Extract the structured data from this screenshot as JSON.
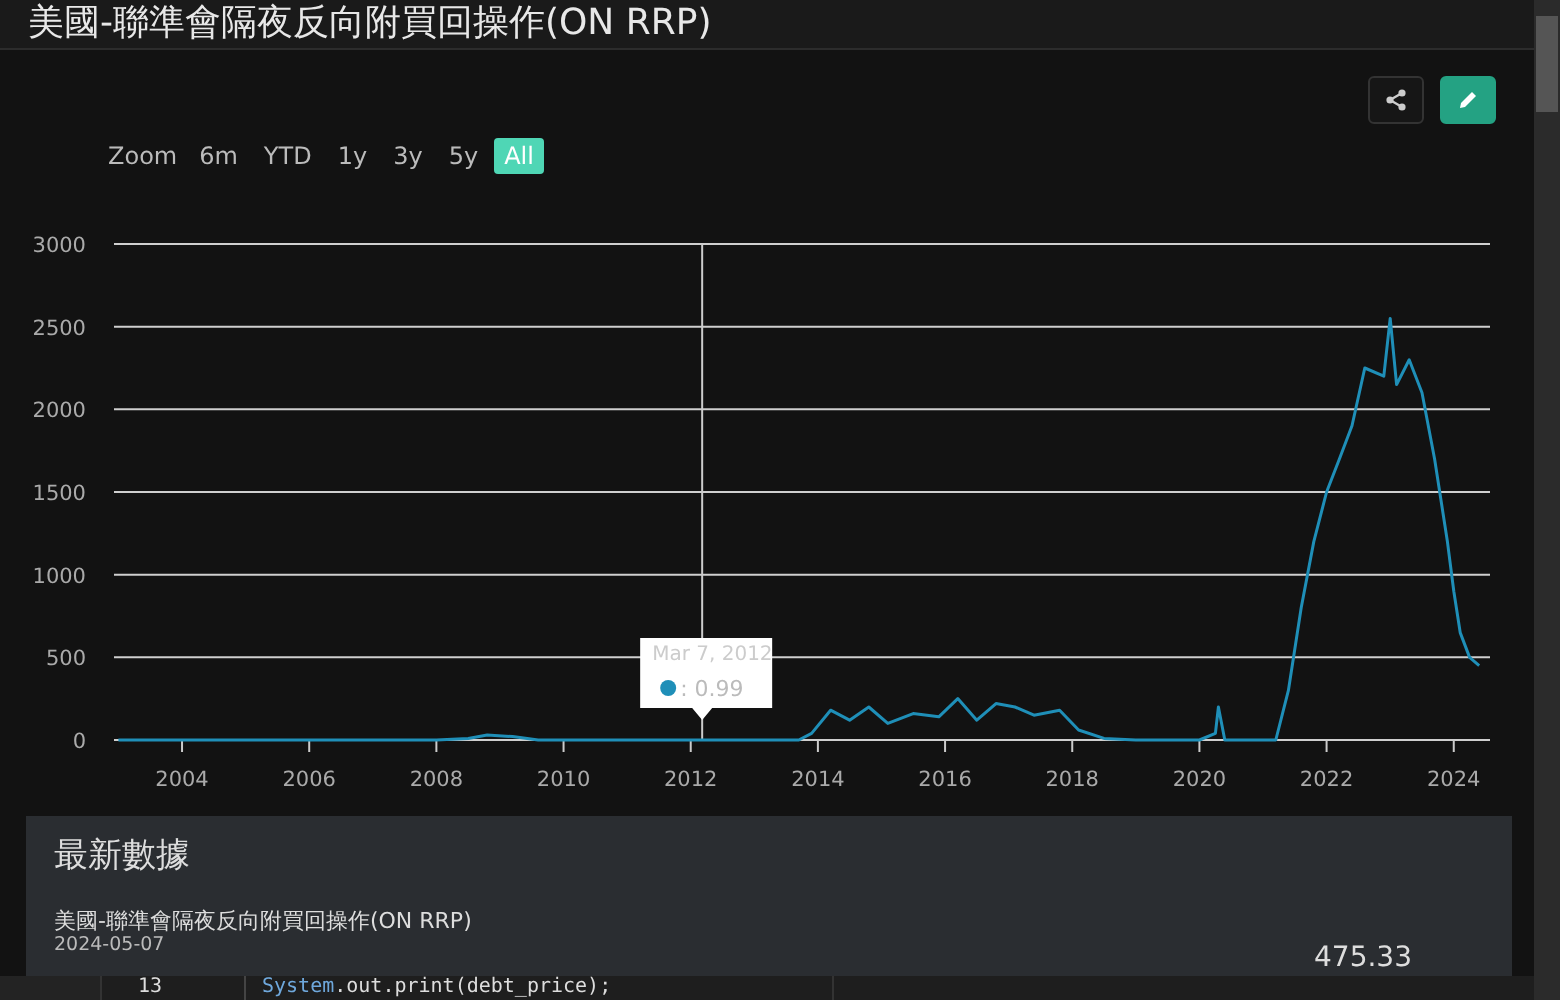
{
  "header": {
    "title": "美國-聯準會隔夜反向附買回操作(ON RRP)"
  },
  "chart_toolbar": {
    "buttons": [
      {
        "kind": "share",
        "selected": false
      },
      {
        "kind": "edit",
        "selected": true
      }
    ]
  },
  "range_selector": {
    "label": "Zoom",
    "options": [
      {
        "label": "6m",
        "selected": false
      },
      {
        "label": "YTD",
        "selected": false
      },
      {
        "label": "1y",
        "selected": false
      },
      {
        "label": "3y",
        "selected": false
      },
      {
        "label": "5y",
        "selected": false
      },
      {
        "label": "All",
        "selected": true
      }
    ]
  },
  "chart": {
    "chart_data": {
      "type": "line",
      "x": [
        2003.0,
        2008.0,
        2008.5,
        2008.8,
        2009.2,
        2009.6,
        2013.7,
        2013.9,
        2014.2,
        2014.5,
        2014.8,
        2015.1,
        2015.5,
        2015.9,
        2016.2,
        2016.5,
        2016.8,
        2017.1,
        2017.4,
        2017.8,
        2018.1,
        2018.5,
        2019.0,
        2020.0,
        2020.25,
        2020.3,
        2020.4,
        2021.2,
        2021.4,
        2021.6,
        2021.8,
        2022.0,
        2022.2,
        2022.4,
        2022.6,
        2022.9,
        2023.0,
        2023.1,
        2023.3,
        2023.5,
        2023.7,
        2023.9,
        2024.0,
        2024.1,
        2024.25,
        2024.4
      ],
      "series": [
        {
          "color": "#1f8fb8",
          "values": [
            0,
            0,
            10,
            30,
            20,
            0,
            0,
            40,
            180,
            120,
            200,
            100,
            160,
            140,
            250,
            120,
            220,
            200,
            150,
            180,
            60,
            10,
            0,
            0,
            40,
            200,
            0,
            0,
            300,
            800,
            1200,
            1500,
            1700,
            1900,
            2250,
            2200,
            2550,
            2150,
            2300,
            2100,
            1700,
            1200,
            900,
            650,
            500,
            450
          ]
        }
      ],
      "grid": true,
      "ref_lines": [
        {
          "axis": "x",
          "value": 2012.18
        }
      ],
      "xlim": [
        2002.93,
        2024.57
      ],
      "ylim": [
        0,
        3000
      ],
      "xticks": [
        2004,
        2006,
        2008,
        2010,
        2012,
        2014,
        2016,
        2018,
        2020,
        2022,
        2024
      ],
      "yticks": [
        0,
        500,
        1000,
        1500,
        2000,
        2500,
        3000
      ]
    },
    "tooltip": {
      "date": "Mar 7, 2012",
      "value": ": 0.99"
    }
  },
  "latest": {
    "heading": "最新數據",
    "series_name": "美國-聯準會隔夜反向附買回操作(ON RRP)",
    "date": "2024-05-07",
    "value": "475.33"
  },
  "code_line": {
    "number": "13",
    "tokens": [
      {
        "kind": "class",
        "text": "System"
      },
      {
        "kind": "plain",
        "text": ".out.print(debt_price);"
      }
    ]
  }
}
